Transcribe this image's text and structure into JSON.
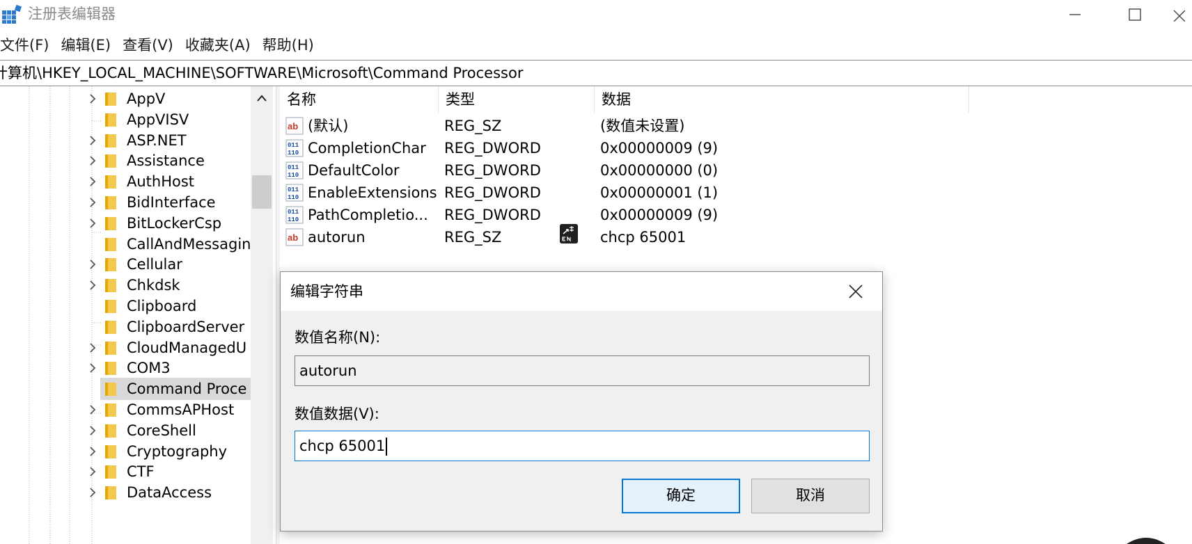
{
  "window": {
    "title": "注册表编辑器"
  },
  "menu": {
    "items": [
      "文件(F)",
      "编辑(E)",
      "查看(V)",
      "收藏夹(A)",
      "帮助(H)"
    ]
  },
  "address": {
    "path": "计算机\\HKEY_LOCAL_MACHINE\\SOFTWARE\\Microsoft\\Command Processor"
  },
  "tree": {
    "items": [
      {
        "label": "AppV",
        "expandable": true,
        "selected": false
      },
      {
        "label": "AppVISV",
        "expandable": false,
        "selected": false
      },
      {
        "label": "ASP.NET",
        "expandable": true,
        "selected": false
      },
      {
        "label": "Assistance",
        "expandable": true,
        "selected": false
      },
      {
        "label": "AuthHost",
        "expandable": true,
        "selected": false
      },
      {
        "label": "BidInterface",
        "expandable": true,
        "selected": false
      },
      {
        "label": "BitLockerCsp",
        "expandable": true,
        "selected": false
      },
      {
        "label": "CallAndMessagin",
        "expandable": false,
        "selected": false
      },
      {
        "label": "Cellular",
        "expandable": true,
        "selected": false
      },
      {
        "label": "Chkdsk",
        "expandable": true,
        "selected": false
      },
      {
        "label": "Clipboard",
        "expandable": false,
        "selected": false
      },
      {
        "label": "ClipboardServer",
        "expandable": false,
        "selected": false
      },
      {
        "label": "CloudManagedU",
        "expandable": true,
        "selected": false
      },
      {
        "label": "COM3",
        "expandable": true,
        "selected": false
      },
      {
        "label": "Command Proce",
        "expandable": false,
        "selected": true
      },
      {
        "label": "CommsAPHost",
        "expandable": true,
        "selected": false
      },
      {
        "label": "CoreShell",
        "expandable": true,
        "selected": false
      },
      {
        "label": "Cryptography",
        "expandable": true,
        "selected": false
      },
      {
        "label": "CTF",
        "expandable": true,
        "selected": false
      },
      {
        "label": "DataAccess",
        "expandable": true,
        "selected": false
      }
    ]
  },
  "list": {
    "columns": {
      "name": "名称",
      "type": "类型",
      "data": "数据"
    },
    "rows": [
      {
        "icon": "string-value-icon",
        "name": "(默认)",
        "type": "REG_SZ",
        "data": "(数值未设置)"
      },
      {
        "icon": "binary-value-icon",
        "name": "CompletionChar",
        "type": "REG_DWORD",
        "data": "0x00000009 (9)"
      },
      {
        "icon": "binary-value-icon",
        "name": "DefaultColor",
        "type": "REG_DWORD",
        "data": "0x00000000 (0)"
      },
      {
        "icon": "binary-value-icon",
        "name": "EnableExtensions",
        "type": "REG_DWORD",
        "data": "0x00000001 (1)"
      },
      {
        "icon": "binary-value-icon",
        "name": "PathCompletio...",
        "type": "REG_DWORD",
        "data": "0x00000009 (9)"
      },
      {
        "icon": "string-value-icon",
        "name": "autorun",
        "type": "REG_SZ",
        "data": "chcp 65001"
      }
    ]
  },
  "dialog": {
    "title": "编辑字符串",
    "name_label": "数值名称(N):",
    "name_value": "autorun",
    "data_label": "数值数据(V):",
    "data_value": "chcp 65001",
    "ok_label": "确定",
    "cancel_label": "取消"
  },
  "colors": {
    "accent": "#0078d7",
    "folder": "#f2c94c",
    "selection": "#d9d9d9",
    "dialog_bg": "#f0f0f0"
  }
}
